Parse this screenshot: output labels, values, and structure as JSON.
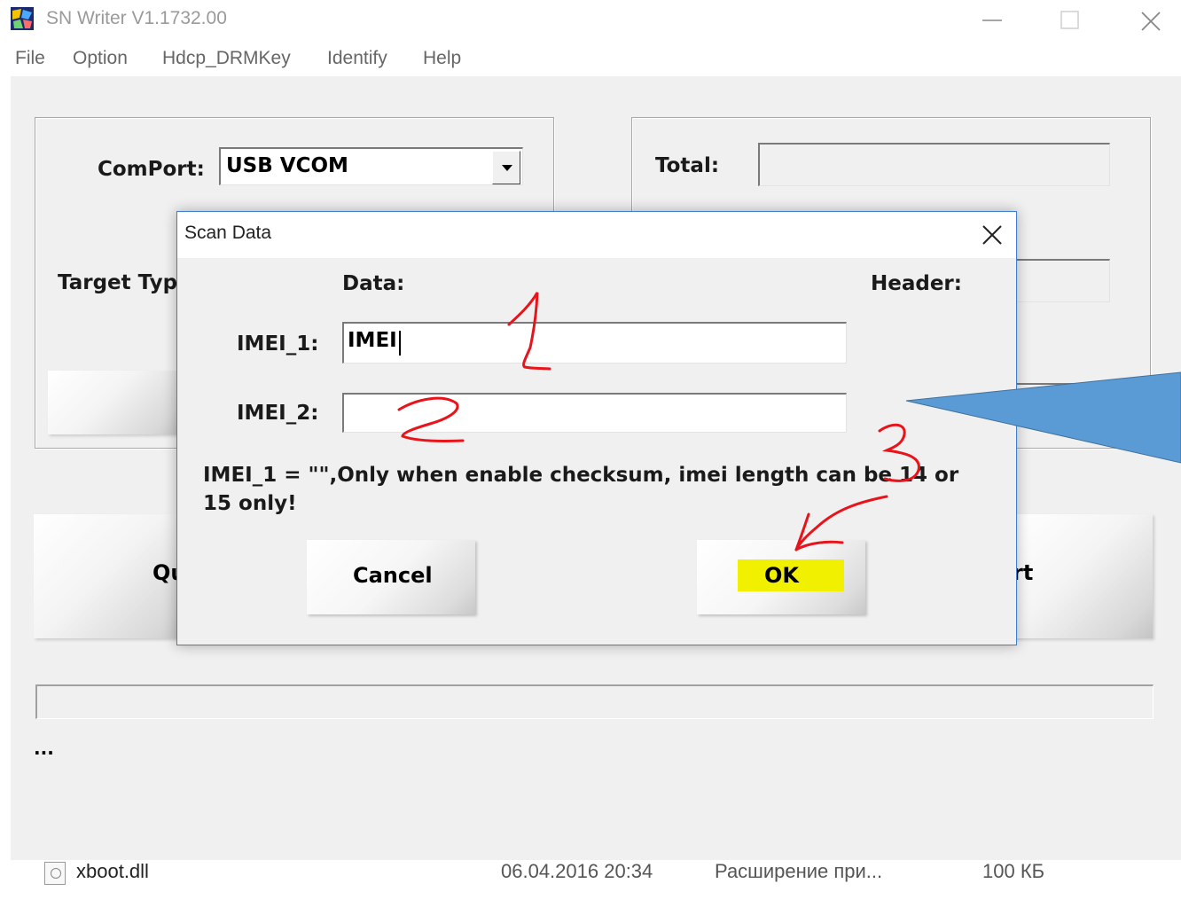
{
  "window": {
    "title": "SN Writer V1.1732.00",
    "icon": "app-logo-icon",
    "controls": [
      "minimize-icon",
      "maximize-icon",
      "close-icon"
    ]
  },
  "menu": [
    "File",
    "Option",
    "Hdcp_DRMKey",
    "Identify",
    "Help"
  ],
  "main": {
    "comport_label": "ComPort:",
    "comport_value": "USB VCOM",
    "target_label": "Target Typ",
    "total_label": "Total:",
    "left_big_button": "Qu",
    "right_big_button": "rt",
    "status_text": "..."
  },
  "dialog": {
    "title": "Scan Data",
    "data_label": "Data:",
    "header_label": "Header:",
    "imei1_label": "IMEI_1:",
    "imei1_value": "IMEI",
    "imei2_label": "IMEI_2:",
    "imei2_value": "",
    "message_line1": "IMEI_1 = \"\",Only when enable checksum, imei length can be 14 or",
    "message_line2": "15 only!",
    "cancel_label": "Cancel",
    "ok_label": "OK",
    "ok_highlight_color": "#f0f000"
  },
  "annotations": {
    "marks": [
      "1",
      "2",
      "3"
    ],
    "mark_color": "#e8141b",
    "arrow_color": "#5b9bd5"
  },
  "explorer_row": {
    "name": "xboot.dll",
    "date": "06.04.2016 20:34",
    "type": "Расширение при...",
    "size": "100 КБ"
  }
}
